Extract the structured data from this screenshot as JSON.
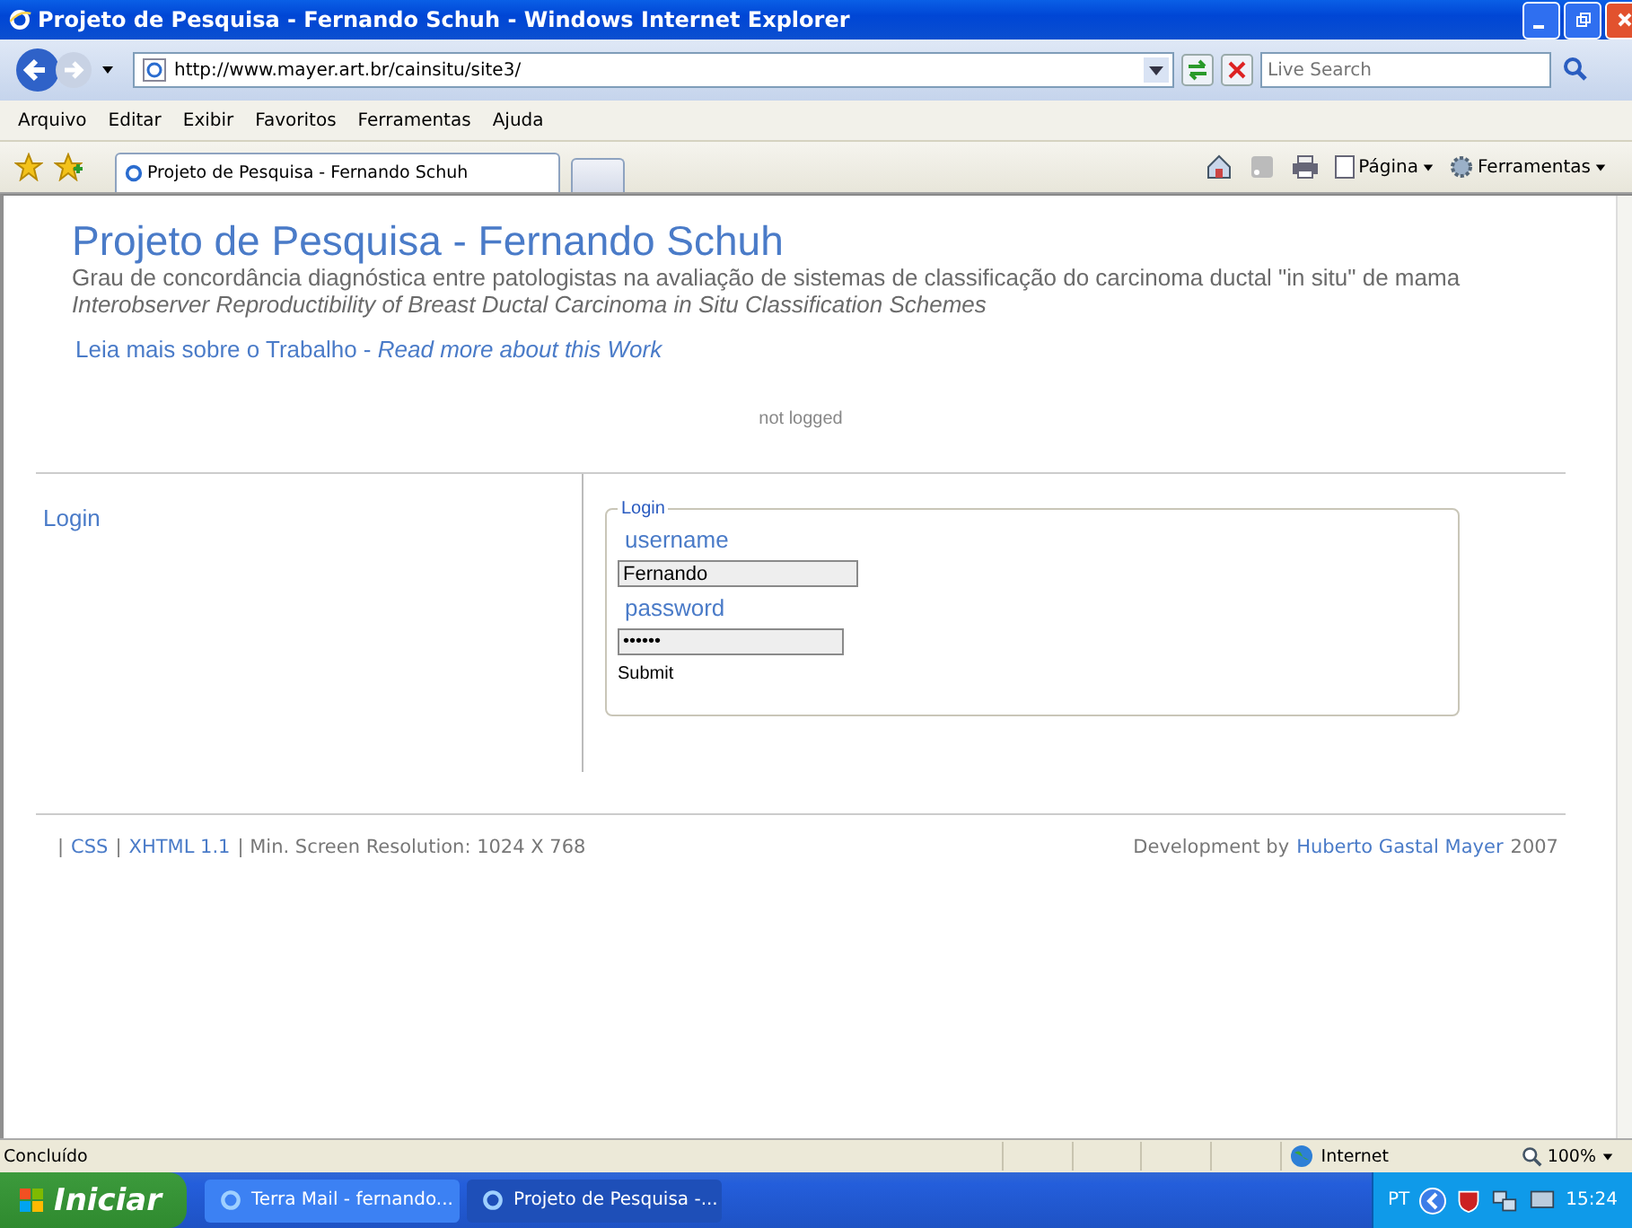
{
  "window": {
    "title": "Projeto de Pesquisa - Fernando Schuh - Windows Internet Explorer"
  },
  "address_bar": {
    "url": "http://www.mayer.art.br/cainsitu/site3/",
    "search_placeholder": "Live Search"
  },
  "menu": [
    "Arquivo",
    "Editar",
    "Exibir",
    "Favoritos",
    "Ferramentas",
    "Ajuda"
  ],
  "tabs": [
    {
      "label": "Projeto de Pesquisa - Fernando Schuh",
      "selected": true
    }
  ],
  "command_bar": [
    "Página",
    "Ferramentas"
  ],
  "page": {
    "title": "Projeto de Pesquisa - Fernando Schuh",
    "subtitle": "Grau de concordância diagnóstica entre patologistas na avaliação de sistemas de classificação do carcinoma ductal \"in situ\" de mama",
    "subtitle_en": "Interobserver Reproductibility of Breast Ductal Carcinoma in Situ Classification Schemes",
    "read_more": "Leia mais sobre o Trabalho - ",
    "read_more_en": "Read more about this Work",
    "status": "not logged",
    "side_link": "Login",
    "form": {
      "legend": "Login",
      "username_label": "username",
      "username": "Fernando",
      "password_label": "password",
      "password": "••••••",
      "submit": "Submit"
    },
    "footer_left": [
      {
        "text": "|",
        "kind": "plain"
      },
      {
        "text": "CSS",
        "kind": "link"
      },
      {
        "text": "|",
        "kind": "plain"
      },
      {
        "text": "XHTML 1.1",
        "kind": "link"
      },
      {
        "text": "| Min. Screen Resolution: 1024 X 768",
        "kind": "plain"
      }
    ],
    "footer_right": [
      {
        "text": "Development by",
        "kind": "plain"
      },
      {
        "text": "Huberto Gastal Mayer",
        "kind": "link"
      },
      {
        "text": "2007",
        "kind": "plain"
      }
    ]
  },
  "status_bar": {
    "text": "Concluído",
    "zone": "Internet",
    "zoom": "100%"
  },
  "taskbar": {
    "start": "Iniciar",
    "items": [
      {
        "label": "Terra Mail - fernando...",
        "selected": false
      },
      {
        "label": "Projeto de Pesquisa -...",
        "selected": true
      }
    ],
    "lang": "PT",
    "time": "15:24"
  }
}
